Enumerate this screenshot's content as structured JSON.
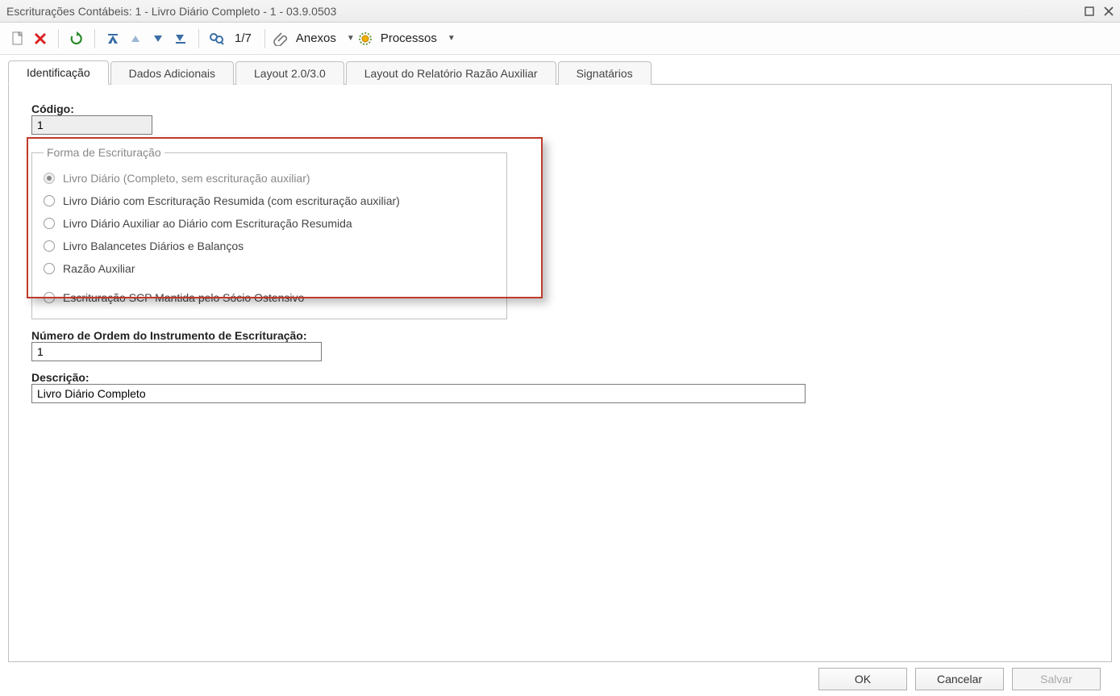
{
  "window": {
    "title": "Escriturações Contábeis: 1 - Livro Diário Completo - 1 - 03.9.0503"
  },
  "toolbar": {
    "page_counter": "1/7",
    "anexos_label": "Anexos",
    "processos_label": "Processos"
  },
  "tabs": [
    {
      "label": "Identificação",
      "active": true
    },
    {
      "label": "Dados Adicionais",
      "active": false
    },
    {
      "label": "Layout 2.0/3.0",
      "active": false
    },
    {
      "label": "Layout do Relatório Razão Auxiliar",
      "active": false
    },
    {
      "label": "Signatários",
      "active": false
    }
  ],
  "form": {
    "codigo_label": "Código:",
    "codigo_value": "1",
    "forma_legend": "Forma de Escrituração",
    "radios": [
      {
        "label": "Livro Diário (Completo, sem escrituração auxiliar)",
        "selected": true,
        "inside": true,
        "disabled": true
      },
      {
        "label": "Livro Diário com Escrituração Resumida (com escrituração auxiliar)",
        "selected": false,
        "inside": true,
        "disabled": false
      },
      {
        "label": "Livro Diário Auxiliar ao Diário com Escrituração Resumida",
        "selected": false,
        "inside": true,
        "disabled": false
      },
      {
        "label": "Livro Balancetes Diários e Balanços",
        "selected": false,
        "inside": true,
        "disabled": false
      },
      {
        "label": "Razão Auxiliar",
        "selected": false,
        "inside": true,
        "disabled": false
      },
      {
        "label": "Escrituração SCP Mantida pelo Sócio Ostensivo",
        "selected": false,
        "inside": false,
        "disabled": false
      }
    ],
    "ordem_label": "Número de Ordem do Instrumento de Escrituração:",
    "ordem_value": "1",
    "descricao_label": "Descrição:",
    "descricao_value": "Livro Diário Completo"
  },
  "footer": {
    "ok": "OK",
    "cancelar": "Cancelar",
    "salvar": "Salvar"
  },
  "colors": {
    "highlight_border": "#c0392b"
  }
}
